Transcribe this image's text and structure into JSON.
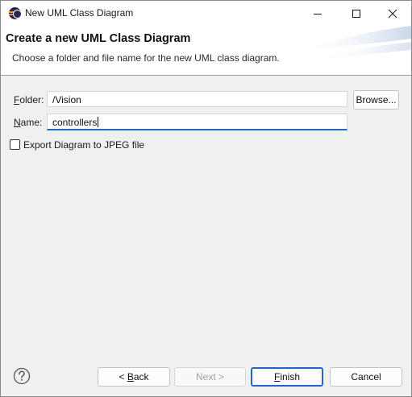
{
  "window": {
    "title": "New UML Class Diagram",
    "app_icon": "eclipse-icon"
  },
  "header": {
    "title": "Create a new UML Class Diagram",
    "description": "Choose a folder and file name for the new UML class diagram."
  },
  "form": {
    "folder": {
      "label_mnemonic": "F",
      "label_rest": "older:",
      "value": "/Vision"
    },
    "name": {
      "label_mnemonic": "N",
      "label_rest": "ame:",
      "value": "controllers"
    },
    "browse_label": "Browse...",
    "export_checkbox": {
      "label": "Export Diagram to JPEG file",
      "checked": false
    }
  },
  "footer": {
    "help_icon": "help-icon",
    "back": {
      "prefix": "< ",
      "mnemonic": "B",
      "rest": "ack"
    },
    "next": {
      "label": "Next >",
      "enabled": false
    },
    "finish": {
      "mnemonic": "F",
      "rest": "inish"
    },
    "cancel_label": "Cancel"
  },
  "colors": {
    "focus_accent": "#2563c7",
    "dialog_bg": "#f0f0f0",
    "header_bg": "#ffffff"
  }
}
